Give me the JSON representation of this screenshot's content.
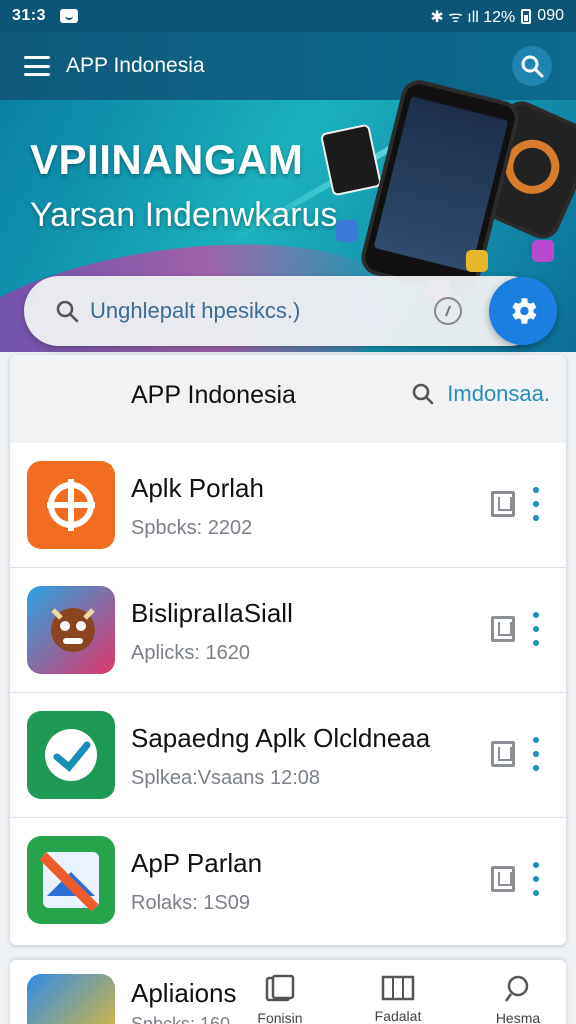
{
  "status_bar": {
    "time": "31:3",
    "indicators": "✱ ᯤ ıll 12%",
    "battery": "090"
  },
  "app_bar": {
    "title": "APP Indonesia",
    "menu_icon": "hamburger-icon",
    "search_icon": "search-icon"
  },
  "hero": {
    "headline": "VPIINANGAM",
    "subline": "Yarsan Indenwkarus"
  },
  "search": {
    "placeholder": "Unghlepalt hpesikcs.)"
  },
  "list": {
    "header": {
      "title": "APP Indonesia",
      "search_label": "Imdonsaa."
    },
    "apps": [
      {
        "name": "Aplk Porlah",
        "meta": "Spbcks: 2202",
        "icon": "orange-app-icon"
      },
      {
        "name": "BislipraIlaSiall",
        "meta": "Aplicks: 1620",
        "icon": "monster-app-icon"
      },
      {
        "name": "Sapaedng Aplk Olcldneaa",
        "meta": "Splkea:Vsaans 12:08",
        "icon": "green-clock-app-icon"
      },
      {
        "name": "ApP Parlan",
        "meta": "Rolaks: 1S09",
        "icon": "map-app-icon"
      }
    ]
  },
  "bottom": {
    "app": {
      "name": "Apliaions",
      "meta": "Spbcks: 160"
    },
    "nav": [
      {
        "label": "Fonisin",
        "icon": "card-icon"
      },
      {
        "label": "Fadalat",
        "icon": "grid-icon"
      },
      {
        "label": "Hesma",
        "icon": "search-icon"
      }
    ]
  },
  "colors": {
    "app_bar": "#0f5a7c",
    "accent": "#1a7fe0",
    "link": "#2a8db8"
  }
}
